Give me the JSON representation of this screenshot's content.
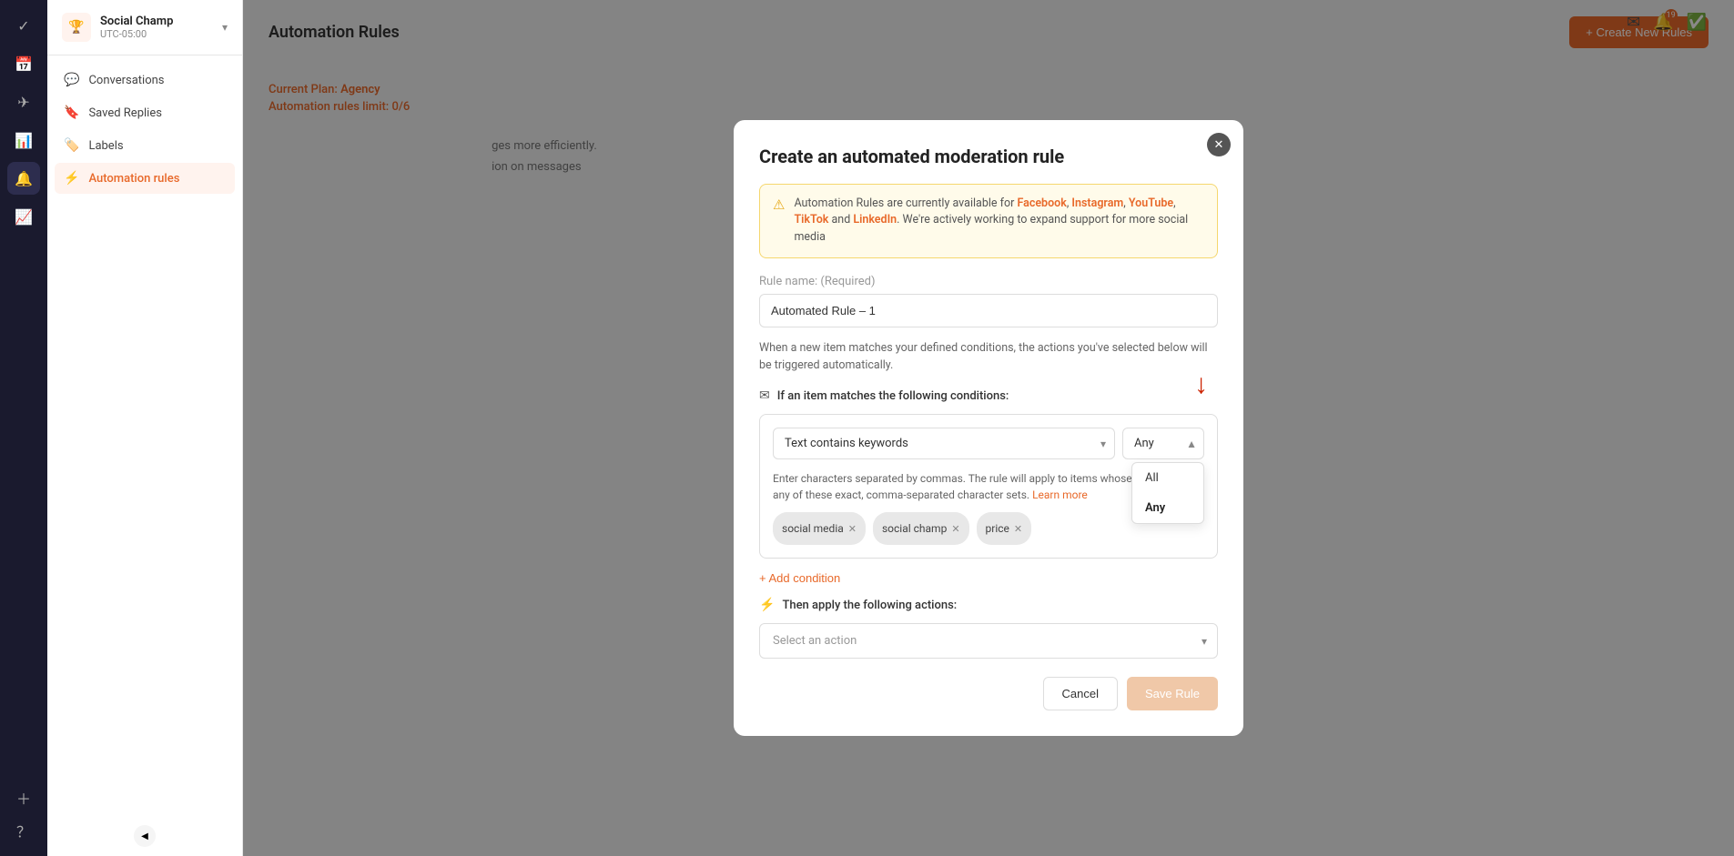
{
  "app": {
    "name": "Social Champ",
    "timezone": "UTC-05:00"
  },
  "top_right": {
    "notification_count": "19"
  },
  "sidebar": {
    "header": {
      "title": "Social Champ",
      "subtitle": "UTC-05:00",
      "chevron": "▾"
    },
    "nav_items": [
      {
        "id": "conversations",
        "label": "Conversations",
        "icon": "💬",
        "active": false
      },
      {
        "id": "saved-replies",
        "label": "Saved Replies",
        "icon": "🔖",
        "active": false
      },
      {
        "id": "labels",
        "label": "Labels",
        "icon": "🏷️",
        "active": false
      },
      {
        "id": "automation-rules",
        "label": "Automation rules",
        "icon": "⚡",
        "active": true
      }
    ]
  },
  "main": {
    "title": "Automation Rules",
    "plan_label": "Current Plan:",
    "plan_name": "Agency",
    "limit_label": "Automation rules limit:",
    "limit_value": "0/6",
    "create_btn": "+ Create New Rules"
  },
  "modal": {
    "title": "Create an automated moderation rule",
    "close_label": "✕",
    "warning": {
      "icon": "⚠",
      "text_before": "Automation Rules are currently available for ",
      "platforms": "Facebook, Instagram, YouTube, TikTok",
      "text_middle": " and ",
      "platform_last": "LinkedIn",
      "text_after": ". We're actively working to expand support for more social media"
    },
    "rule_name_label": "Rule name:",
    "rule_name_required": "(Required)",
    "rule_name_value": "Automated Rule – 1",
    "description": "When a new item matches your defined conditions, the actions you've selected below will be triggered automatically.",
    "conditions_header": "If an item matches the following conditions:",
    "condition_type": "Text contains keywords",
    "condition_type_arrow": "▾",
    "any_options": [
      "All",
      "Any"
    ],
    "any_selected": "Any",
    "condition_hint": "Enter characters separated by commas. The rule will apply to items whose text contains any of these exact, comma-separated character sets.",
    "learn_more": "Learn more",
    "tags": [
      "social media",
      "social champ",
      "price"
    ],
    "add_condition_label": "+ Add condition",
    "actions_header": "Then apply the following actions:",
    "action_placeholder": "Select an action",
    "cancel_label": "Cancel",
    "save_label": "Save Rule"
  },
  "icons": {
    "calendar": "📅",
    "send": "📤",
    "chart": "📊",
    "engagement": "🔔",
    "analytics": "📈",
    "add": "+",
    "help": "?"
  }
}
